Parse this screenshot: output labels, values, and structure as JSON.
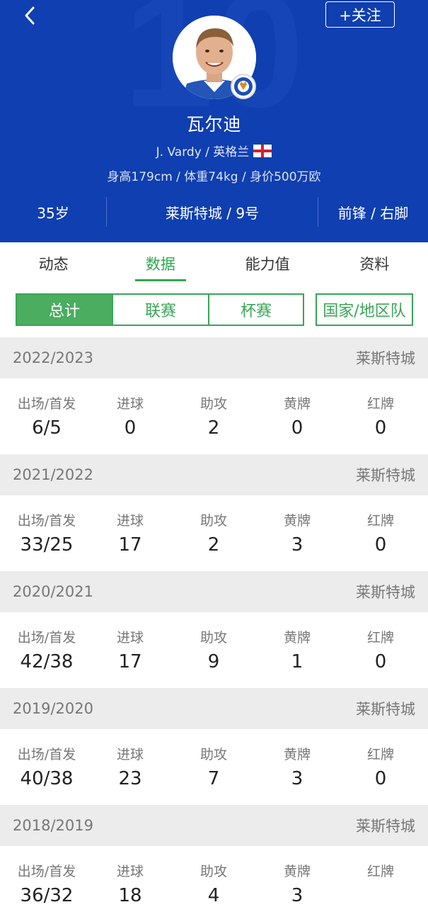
{
  "header": {
    "follow_label": "+关注",
    "name": "瓦尔迪",
    "english_name": "J. Vardy / 英格兰",
    "meta": "身高179cm / 体重74kg / 身价500万欧",
    "age": "35岁",
    "club_number": "莱斯特城 / 9号",
    "position_foot": "前锋 / 右脚",
    "icons": {
      "back": "chevron-left-icon",
      "flag": "england-flag-icon",
      "badge": "leicester-badge-icon"
    },
    "colors": {
      "background": "#0f3fb0"
    }
  },
  "tabs": [
    "动态",
    "数据",
    "能力值",
    "资料"
  ],
  "active_tab": "数据",
  "segments": [
    "总计",
    "联赛",
    "杯赛",
    "国家/地区队"
  ],
  "active_segment": "总计",
  "stat_labels": [
    "出场/首发",
    "进球",
    "助攻",
    "黄牌",
    "红牌"
  ],
  "seasons": [
    {
      "season": "2022/2023",
      "team": "莱斯特城",
      "values": [
        "6/5",
        "0",
        "2",
        "0",
        "0"
      ]
    },
    {
      "season": "2021/2022",
      "team": "莱斯特城",
      "values": [
        "33/25",
        "17",
        "2",
        "3",
        "0"
      ]
    },
    {
      "season": "2020/2021",
      "team": "莱斯特城",
      "values": [
        "42/38",
        "17",
        "9",
        "1",
        "0"
      ]
    },
    {
      "season": "2019/2020",
      "team": "莱斯特城",
      "values": [
        "40/38",
        "23",
        "7",
        "3",
        "0"
      ]
    },
    {
      "season": "2018/2019",
      "team": "莱斯特城",
      "values": [
        "36/32",
        "18",
        "4",
        "3",
        ""
      ]
    }
  ],
  "colors": {
    "accent": "#2fa84f",
    "season_bg": "#ececec"
  }
}
